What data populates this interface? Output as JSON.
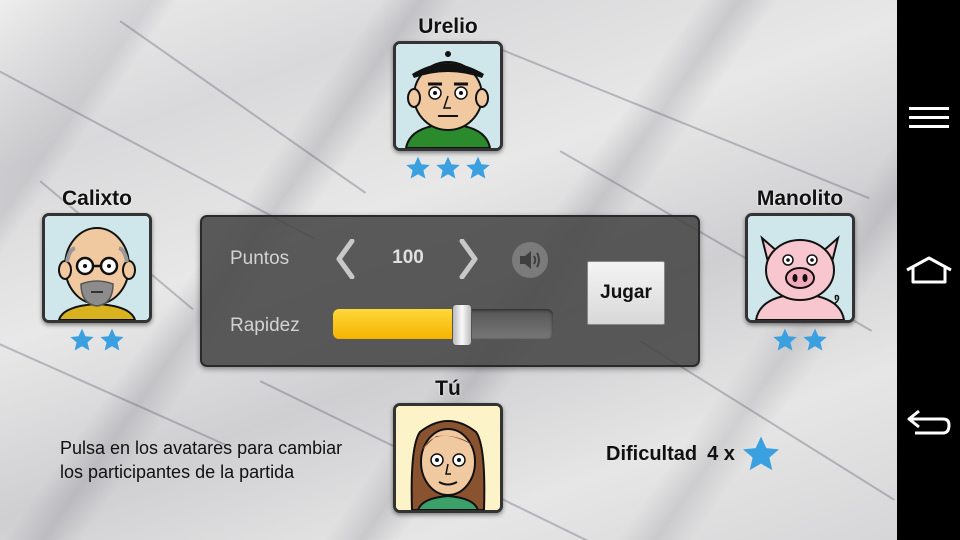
{
  "players": {
    "top": {
      "name": "Urelio",
      "stars": 3
    },
    "left": {
      "name": "Calixto",
      "stars": 2
    },
    "right": {
      "name": "Manolito",
      "stars": 2
    },
    "bottom": {
      "name": "Tú"
    }
  },
  "panel": {
    "points_label": "Puntos",
    "points_value": "100",
    "speed_label": "Rapidez",
    "speed_level": 0.58,
    "play_label": "Jugar"
  },
  "hint": "Pulsa en los avatares para cambiar los participantes de la partida",
  "difficulty": {
    "label": "Dificultad",
    "value": "4 x",
    "icon": "star-icon"
  },
  "colors": {
    "star": "#3aa0e0",
    "slider_fill": "#f5c000"
  },
  "navbar": {
    "icons": [
      "menu-icon",
      "home-icon",
      "back-icon"
    ]
  }
}
